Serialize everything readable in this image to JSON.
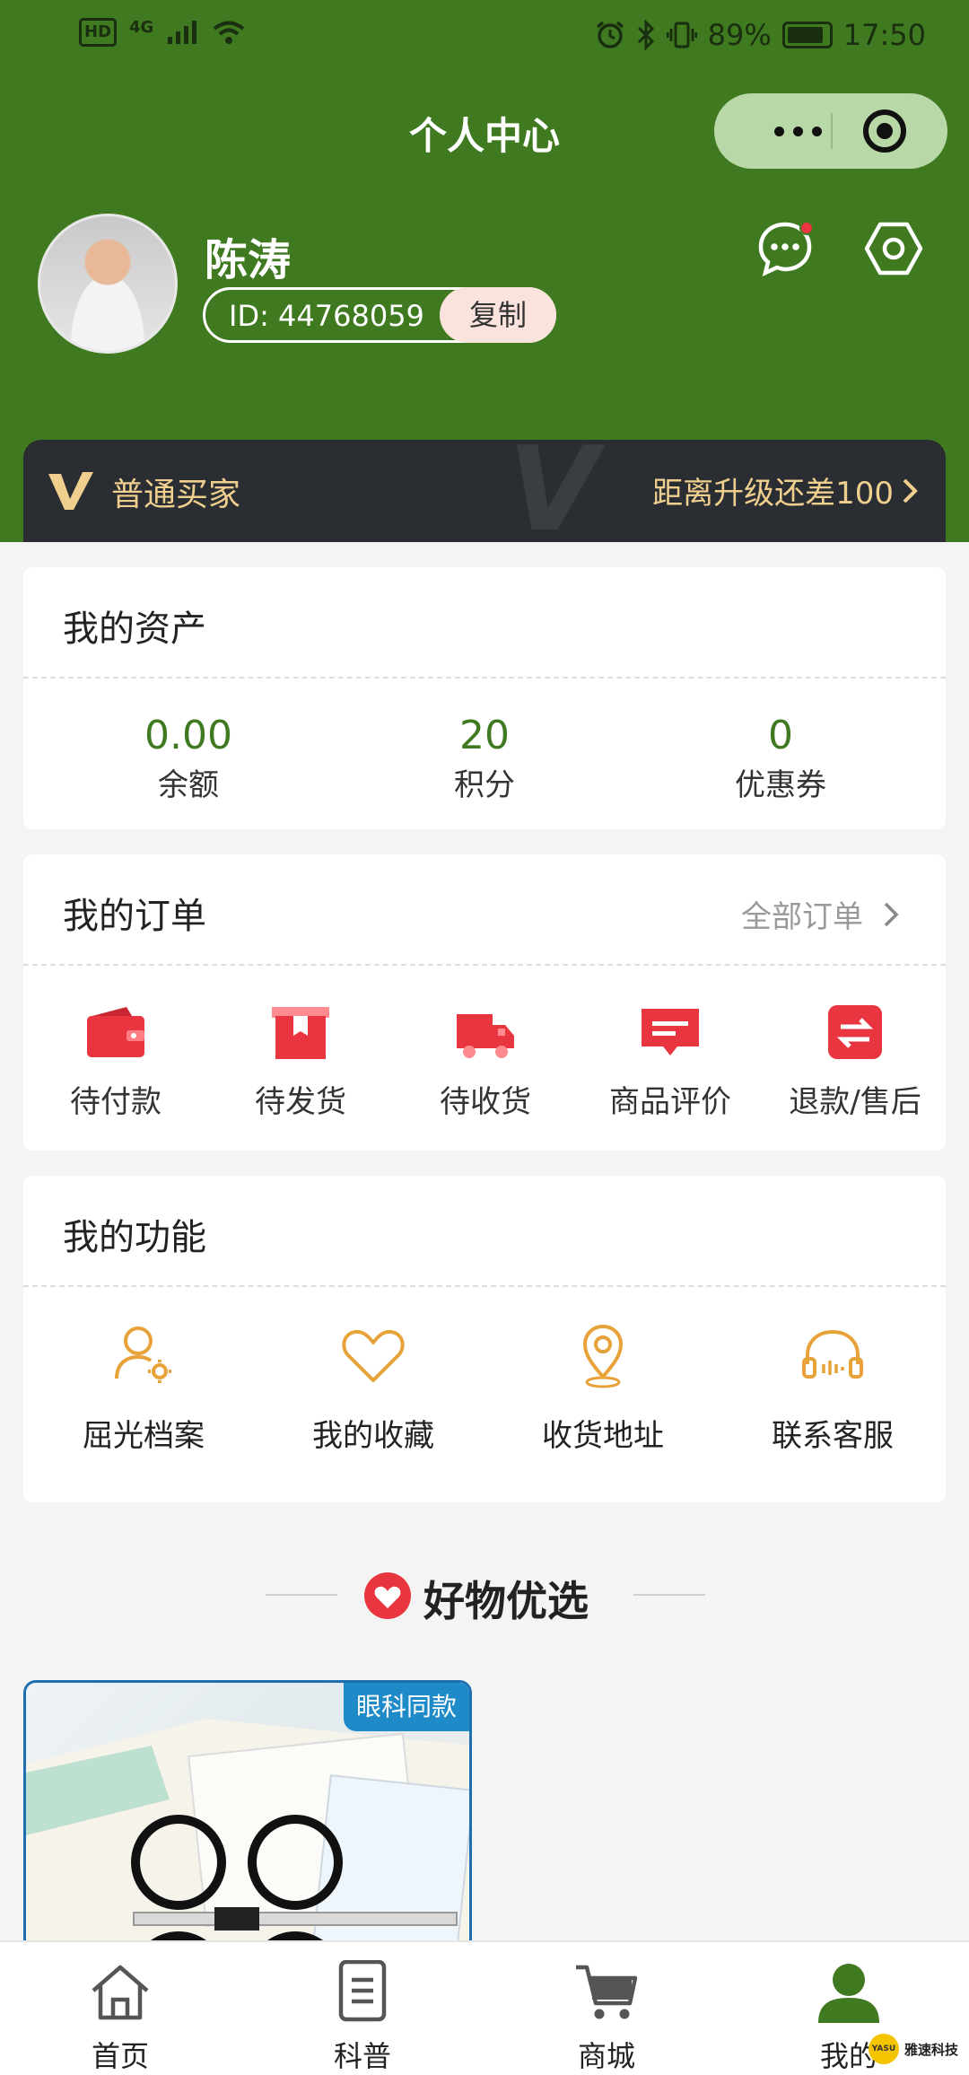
{
  "status_bar": {
    "hd": "HD",
    "network": "4G",
    "battery_percent": "89%",
    "battery_level": 0.89,
    "time": "17:50"
  },
  "header": {
    "title": "个人中心",
    "user_name": "陈涛",
    "user_id": "ID: 44768059",
    "copy_label": "复制",
    "has_unread_message": true
  },
  "vip": {
    "level": "普通买家",
    "upgrade_text": "距离升级还差100"
  },
  "assets": {
    "title": "我的资产",
    "items": [
      {
        "value": "0.00",
        "label": "余额"
      },
      {
        "value": "20",
        "label": "积分"
      },
      {
        "value": "0",
        "label": "优惠券"
      }
    ]
  },
  "orders": {
    "title": "我的订单",
    "all_label": "全部订单",
    "items": [
      {
        "label": "待付款",
        "icon": "wallet-icon"
      },
      {
        "label": "待发货",
        "icon": "package-icon"
      },
      {
        "label": "待收货",
        "icon": "truck-icon"
      },
      {
        "label": "商品评价",
        "icon": "comment-icon"
      },
      {
        "label": "退款/售后",
        "icon": "refund-icon"
      }
    ]
  },
  "functions": {
    "title": "我的功能",
    "items": [
      {
        "label": "屈光档案",
        "icon": "user-settings-icon"
      },
      {
        "label": "我的收藏",
        "icon": "heart-icon"
      },
      {
        "label": "收货地址",
        "icon": "location-icon"
      },
      {
        "label": "联系客服",
        "icon": "headset-icon"
      }
    ]
  },
  "recommend": {
    "title": "好物优选",
    "product_badge": "眼科同款"
  },
  "tabbar": {
    "items": [
      {
        "label": "首页",
        "icon": "home-icon"
      },
      {
        "label": "科普",
        "icon": "document-icon"
      },
      {
        "label": "商城",
        "icon": "cart-icon"
      },
      {
        "label": "我的",
        "icon": "user-icon"
      }
    ],
    "active_index": 3
  },
  "watermark": {
    "logo_text": "YASU",
    "name": "雅速科技"
  },
  "colors": {
    "header_green": "#3f7a20",
    "accent_red": "#e8353f",
    "function_gold": "#e8a23a",
    "vip_gold": "#f0cf8e"
  }
}
